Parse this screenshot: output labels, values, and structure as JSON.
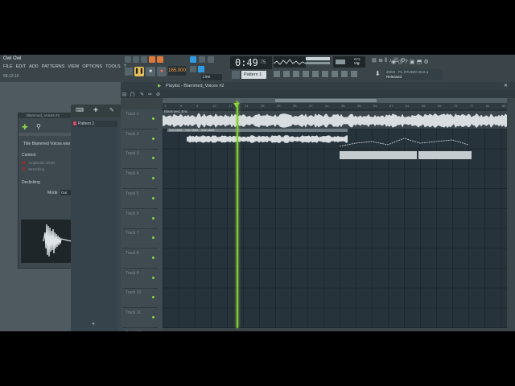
{
  "app": {
    "title": "Owl Owl",
    "time_small": "58:12:19"
  },
  "menu": [
    "FILE",
    "EDIT",
    "ADD",
    "PATTERNS",
    "VIEW",
    "OPTIONS",
    "TOOLS",
    "?"
  ],
  "transport": {
    "tempo": "165.000",
    "time_display": "0:49",
    "time_frac": ":75",
    "pattern": "Pattern 1",
    "cpu": "673 MB",
    "poly": "2",
    "line_mode": "Line"
  },
  "hint": {
    "line1": "20/04 · FL STUDIO 20.6.1",
    "line2": "Released"
  },
  "plugin": {
    "title": "Blammed_Voices #2",
    "file_label": "Title  Blammed Voices.wav",
    "section_content": "Content",
    "row_amp": "Amplitude ADSR",
    "row_stretch": "Stretching",
    "section_declicking": "Declicking",
    "mode_label": "Mode",
    "mode_value": "Out"
  },
  "browser": {
    "pattern_item": "Pattern 1"
  },
  "playlist": {
    "title": "Playlist - Blammed_Voices #2",
    "clip1_label": "Blammed_Enc",
    "clip2_label": "Voc sh#2 · Voc sh#2 · Voc sh#2",
    "tracks": [
      "Track 1",
      "Track 2",
      "Track 3",
      "Track 4",
      "Track 5",
      "Track 6",
      "Track 7",
      "Track 8",
      "Track 9",
      "Track 10",
      "Track 11",
      "Track 12"
    ],
    "bars": [
      "1",
      "5",
      "9",
      "13",
      "17",
      "21",
      "25",
      "29",
      "33",
      "37",
      "41",
      "45",
      "49",
      "53",
      "57",
      "61",
      "65",
      "69",
      "73",
      "77",
      "81",
      "85",
      "89",
      "93",
      "97"
    ]
  },
  "colors": {
    "accent_green": "#8fcf4a",
    "playhead": "#7fd02c",
    "clip_wave": "#d7dde0",
    "grid_bg": "#27333a"
  }
}
